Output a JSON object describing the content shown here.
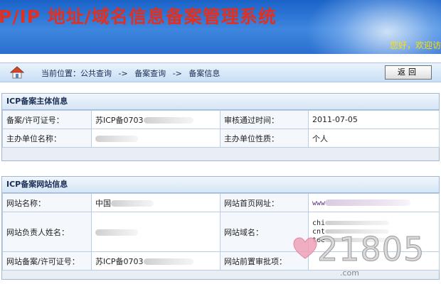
{
  "banner": {
    "title": "P/IP 地址/域名信息备案管理系统",
    "welcome": "您好，欢迎访"
  },
  "nav": {
    "location_label": "当前位置：公共查询",
    "sep1": "->",
    "crumb2": "备案查询",
    "sep2": "->",
    "crumb3": "备案信息",
    "back_button": "返回"
  },
  "subject_panel": {
    "title": "ICP备案主体信息",
    "license_label": "备案/许可证号：",
    "license_value": "苏ICP备0703",
    "approve_time_label": "审核通过时间：",
    "approve_time_value": "2011-07-05",
    "org_name_label": "主办单位名称：",
    "org_type_label": "主办单位性质：",
    "org_type_value": "个人"
  },
  "site_panel": {
    "title": "ICP备案网站信息",
    "site_name_label": "网站名称：",
    "site_name_value": "中国",
    "homepage_label": "网站首页网址：",
    "homepage_value": "www",
    "owner_label": "网站负责人姓名：",
    "domain_label": "网站域名：",
    "domain_values": [
      "chi",
      "cnt",
      "tee"
    ],
    "site_license_label": "网站备案/许可证号：",
    "site_license_value": "苏ICP备0703",
    "pre_approval_label": "网站前置审批项："
  },
  "watermark": {
    "digits": "21805",
    "suffix": ".com"
  },
  "colors": {
    "banner_blue": "#2a6fcf",
    "title_red": "#e23020",
    "welcome_yellow": "#ffe000",
    "panel_border": "#9fb8d8"
  }
}
